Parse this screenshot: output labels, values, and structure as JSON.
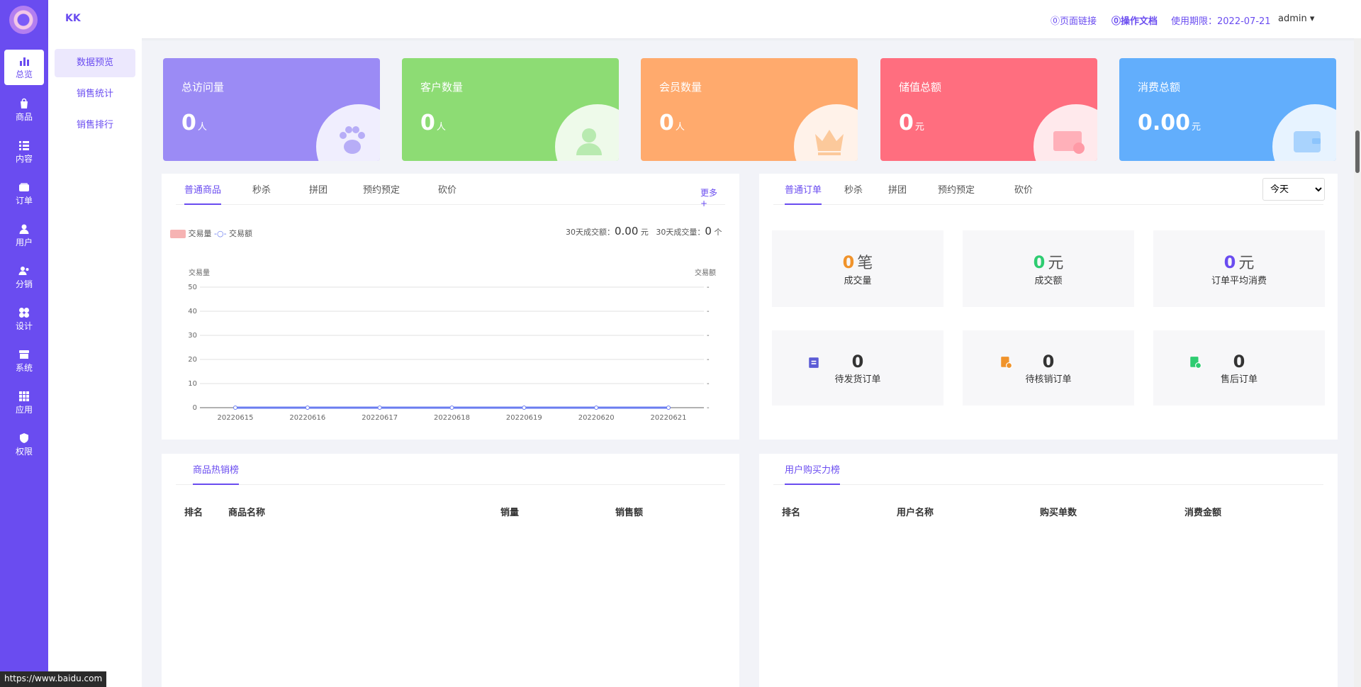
{
  "colors": {
    "accent": "#6a4cf0",
    "card_visits": "#9b8bf5",
    "card_customers": "#8ddc74",
    "card_members": "#ffaa6d",
    "card_stored": "#ff6e7f",
    "card_spend": "#62aefc"
  },
  "sidebar": {
    "items": [
      {
        "label": "总览",
        "icon": "bar-chart-icon"
      },
      {
        "label": "商品",
        "icon": "bag-icon"
      },
      {
        "label": "内容",
        "icon": "list-icon"
      },
      {
        "label": "订单",
        "icon": "wallet-icon"
      },
      {
        "label": "用户",
        "icon": "user-icon"
      },
      {
        "label": "分销",
        "icon": "share-users-icon"
      },
      {
        "label": "设计",
        "icon": "palette-icon"
      },
      {
        "label": "系统",
        "icon": "store-icon"
      },
      {
        "label": "应用",
        "icon": "grid-icon"
      },
      {
        "label": "权限",
        "icon": "shield-icon"
      }
    ]
  },
  "subnav": {
    "items": [
      "数据预览",
      "销售统计",
      "销售排行"
    ]
  },
  "topbar": {
    "brand": "KK",
    "page_link": "⓪页面链接",
    "docs": "⓪操作文档",
    "expiry": "使用期限：2022-07-21",
    "user": "admin"
  },
  "cards": [
    {
      "title": "总访问量",
      "value": "0",
      "unit": "人",
      "icon": "paw-icon"
    },
    {
      "title": "客户数量",
      "value": "0",
      "unit": "人",
      "icon": "users-icon"
    },
    {
      "title": "会员数量",
      "value": "0",
      "unit": "人",
      "icon": "crown-icon"
    },
    {
      "title": "储值总额",
      "value": "0",
      "unit": "元",
      "icon": "card-icon"
    },
    {
      "title": "消费总额",
      "value": "0.00",
      "unit": "元",
      "icon": "wallet-icon"
    }
  ],
  "goods": {
    "tabs": [
      "普通商品",
      "秒杀",
      "拼团",
      "预约预定",
      "砍价"
    ],
    "more": "更多 +",
    "legend": [
      "交易量",
      "交易额"
    ],
    "sum_amount_label": "30天成交额：",
    "sum_amount_value": "0.00",
    "sum_amount_unit": "元",
    "sum_count_label": "30天成交量：",
    "sum_count_value": "0",
    "sum_count_unit": "个"
  },
  "orders": {
    "tabs": [
      "普通订单",
      "秒杀",
      "拼团",
      "预约预定",
      "砍价"
    ],
    "range_selected": "今天",
    "stats": [
      {
        "value": "0",
        "unit": "笔",
        "label": "成交量",
        "color": "#f0932b"
      },
      {
        "value": "0",
        "unit": "元",
        "label": "成交额",
        "color": "#2ecc71"
      },
      {
        "value": "0",
        "unit": "元",
        "label": "订单平均消费",
        "color": "#6a4cf0"
      }
    ],
    "pending": [
      {
        "value": "0",
        "label": "待发货订单",
        "icon": "clipboard-icon",
        "color": "#5b5bd6"
      },
      {
        "value": "0",
        "label": "待核销订单",
        "icon": "doc-clock-icon",
        "color": "#f0932b"
      },
      {
        "value": "0",
        "label": "售后订单",
        "icon": "doc-check-icon",
        "color": "#2ecc71"
      }
    ]
  },
  "hot_goods": {
    "tab": "商品热销榜",
    "columns": [
      "排名",
      "商品名称",
      "销量",
      "销售额"
    ]
  },
  "user_rank": {
    "tab": "用户购买力榜",
    "columns": [
      "排名",
      "用户名称",
      "购买单数",
      "消费金额"
    ]
  },
  "status_bar": "https://www.baidu.com",
  "chart_data": {
    "type": "line",
    "categories": [
      "20220615",
      "20220616",
      "20220617",
      "20220618",
      "20220619",
      "20220620",
      "20220621"
    ],
    "series": [
      {
        "name": "交易量",
        "values": [
          0,
          0,
          0,
          0,
          0,
          0,
          0
        ]
      },
      {
        "name": "交易额",
        "values": [
          0,
          0,
          0,
          0,
          0,
          0,
          0
        ]
      }
    ],
    "ylabel": "交易量",
    "y2label": "交易额",
    "ylim": [
      0,
      50
    ],
    "yticks": [
      0,
      10,
      20,
      30,
      40,
      50
    ],
    "y2ticks": [
      "-",
      "-",
      "-",
      "-",
      "-",
      "-"
    ],
    "grid": true
  }
}
